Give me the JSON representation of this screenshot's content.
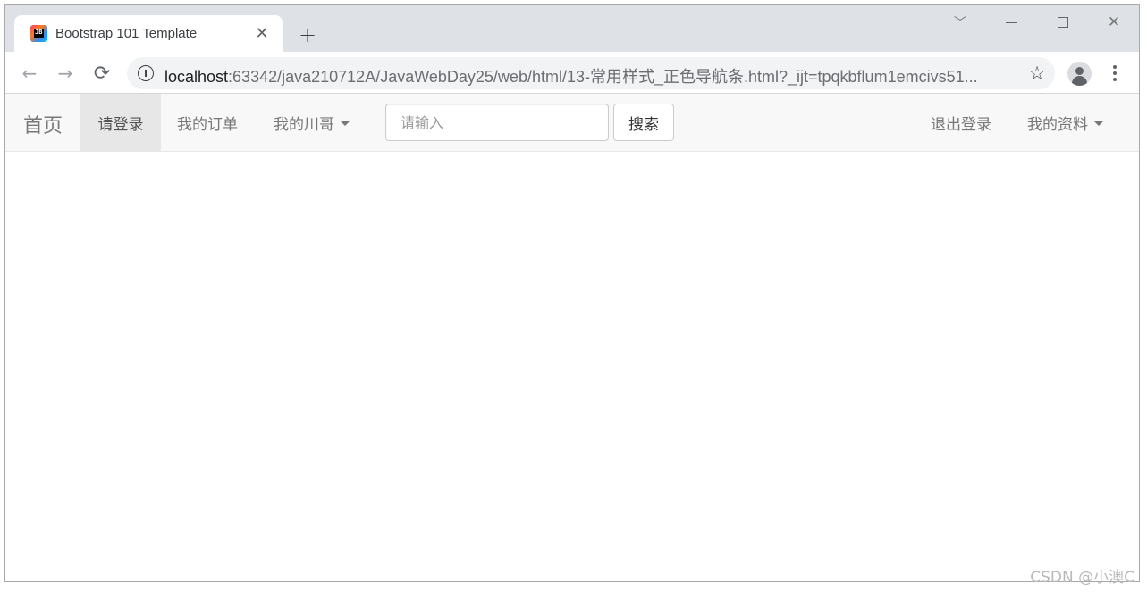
{
  "browser": {
    "tab": {
      "title": "Bootstrap 101 Template",
      "close_glyph": "✕"
    },
    "new_tab_glyph": "+",
    "url": {
      "host": "localhost",
      "path": ":63342/java210712A/JavaWebDay25/web/html/13-常用样式_正色导航条.html?_ijt=tpqkbflum1emcivs51..."
    },
    "icons": {
      "back": "←",
      "forward": "→",
      "reload": "⟳",
      "star": "☆",
      "info": "i",
      "chevron": "﹀",
      "close": "✕"
    }
  },
  "navbar": {
    "brand": "首页",
    "links": {
      "login": "请登录",
      "orders": "我的订单",
      "brother": "我的川哥"
    },
    "search": {
      "placeholder": "请输入",
      "button": "搜索"
    },
    "right": {
      "logout": "退出登录",
      "profile": "我的资料"
    }
  },
  "watermark": "CSDN @小澳C",
  "colors": {
    "navbar_bg": "#f8f8f8",
    "active_bg": "#e7e7e7",
    "link_text": "#777777",
    "tabstrip_bg": "#dee1e6"
  }
}
